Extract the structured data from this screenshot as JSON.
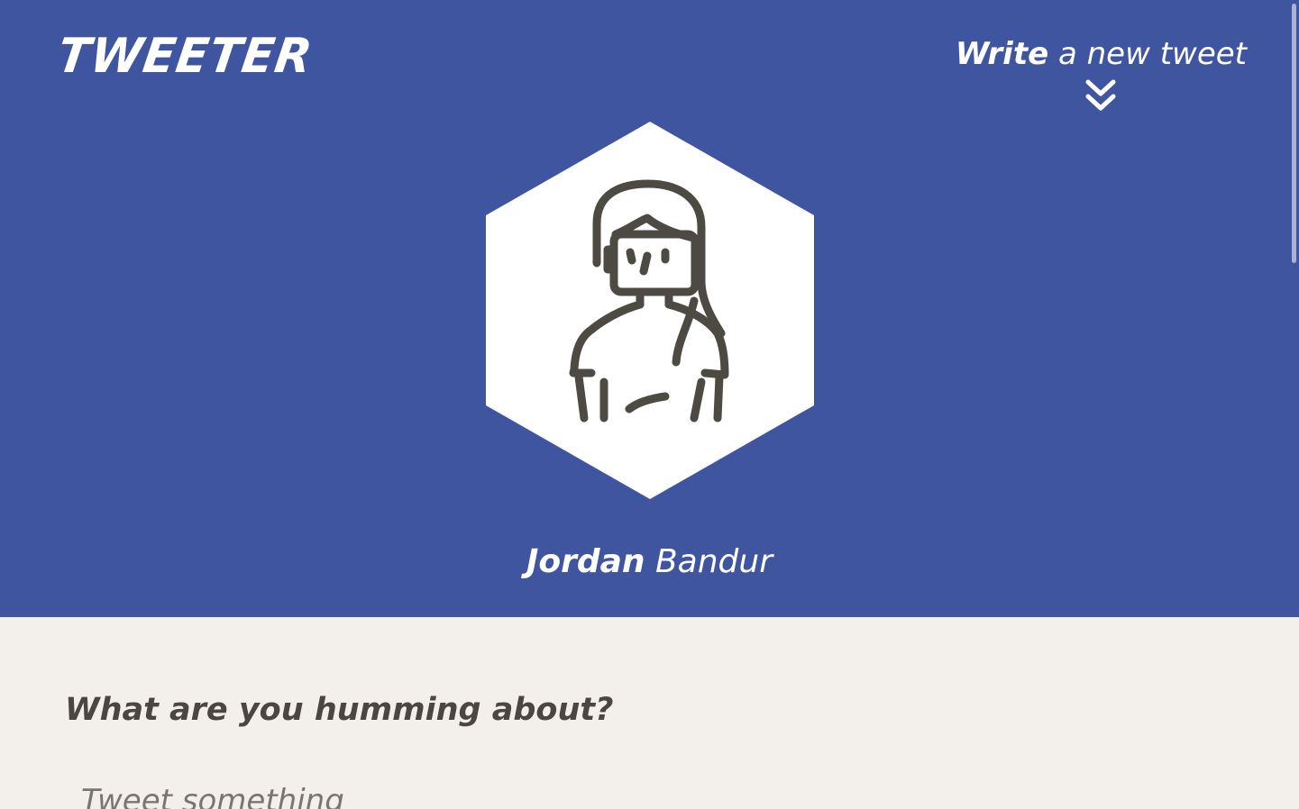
{
  "brand": {
    "logo_text": "TWEETER"
  },
  "compose_toggle": {
    "strong_text": "Write",
    "rest_text": "a new tweet",
    "icon": "double-chevron-down-icon"
  },
  "profile": {
    "avatar_icon": "user-avatar-hexagon",
    "first_name": "Jordan",
    "last_name": "Bandur"
  },
  "compose": {
    "heading": "What are you humming about?",
    "placeholder": "Tweet something"
  },
  "colors": {
    "header_bg": "#4055a0",
    "compose_bg": "#f3f0eb",
    "text_dark": "#4b463f"
  }
}
